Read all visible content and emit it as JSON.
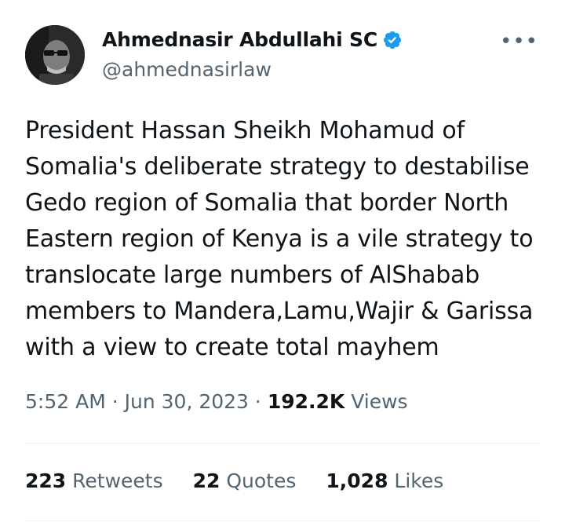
{
  "author": {
    "name": "Ahmednasir Abdullahi SC",
    "handle": "@ahmednasirlaw",
    "verified": true,
    "verified_color": "#1d9bf0"
  },
  "tweet": {
    "text": "President Hassan Sheikh Mohamud of\nSomalia's deliberate strategy to destabilise\nGedo region of Somalia that border North\nEastern region of Kenya is a vile strategy to\ntranslocate large numbers of AlShabab\nmembers to Mandera,Lamu,Wajir & Garissa\nwith a view to create total mayhem",
    "time": "5:52 AM",
    "separator": "·",
    "date": "Jun 30, 2023",
    "views_count": "192.2K",
    "views_label": "Views"
  },
  "stats": {
    "retweets_count": "223",
    "retweets_label": "Retweets",
    "quotes_count": "22",
    "quotes_label": "Quotes",
    "likes_count": "1,028",
    "likes_label": "Likes"
  },
  "icons": {
    "more": "more-horizontal-icon",
    "verified": "verified-badge-icon"
  }
}
